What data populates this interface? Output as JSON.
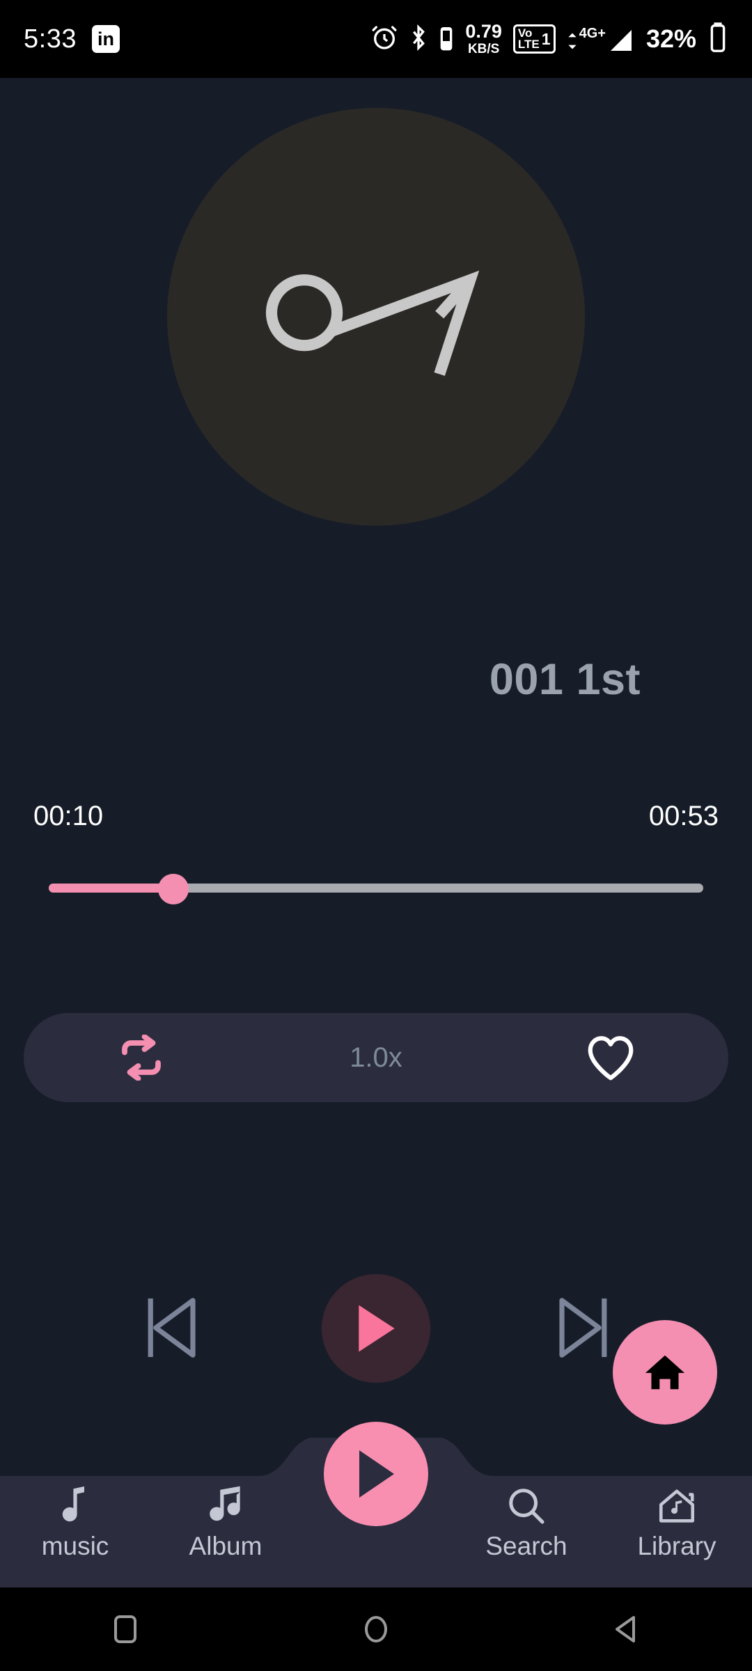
{
  "status_bar": {
    "time": "5:33",
    "linkedin_badge": "in",
    "alarm_icon": "alarm-clock-icon",
    "bluetooth_icon": "bluetooth-icon",
    "bluetooth_battery_icon": "bluetooth-battery-icon",
    "data_rate_value": "0.79",
    "data_rate_unit": "KB/S",
    "volte_top": "Vo",
    "volte_bottom": "LTE",
    "sim_slot": "1",
    "network_type": "4G+",
    "signal_icon": "signal-bars-icon",
    "battery_percent": "32%",
    "battery_icon": "battery-icon"
  },
  "player": {
    "album_art_icon": "music-note-icon",
    "track_title": "001 1st",
    "elapsed_time": "00:10",
    "total_time": "00:53",
    "progress_percent": 19,
    "repeat_icon": "repeat-icon",
    "speed_label": "1.0x",
    "favorite_icon": "heart-outline-icon",
    "previous_icon": "skip-previous-icon",
    "play_icon": "play-icon",
    "next_icon": "skip-next-icon",
    "home_fab_icon": "home-icon"
  },
  "bottom_nav": {
    "items": [
      {
        "label": "music",
        "icon": "single-music-note-icon"
      },
      {
        "label": "Album",
        "icon": "double-music-note-icon"
      },
      {
        "label": "Search",
        "icon": "search-icon"
      },
      {
        "label": "Library",
        "icon": "house-music-icon"
      }
    ],
    "center_fab_icon": "play-icon"
  },
  "android_nav": {
    "recents_icon": "square-recents-icon",
    "home_icon": "circle-home-icon",
    "back_icon": "triangle-back-icon"
  },
  "colors": {
    "background": "#171d28",
    "accent_pink": "#f48fb1",
    "surface": "#2b2d3f",
    "muted_text": "#7e8a99",
    "title_text": "#9aa3ad"
  }
}
